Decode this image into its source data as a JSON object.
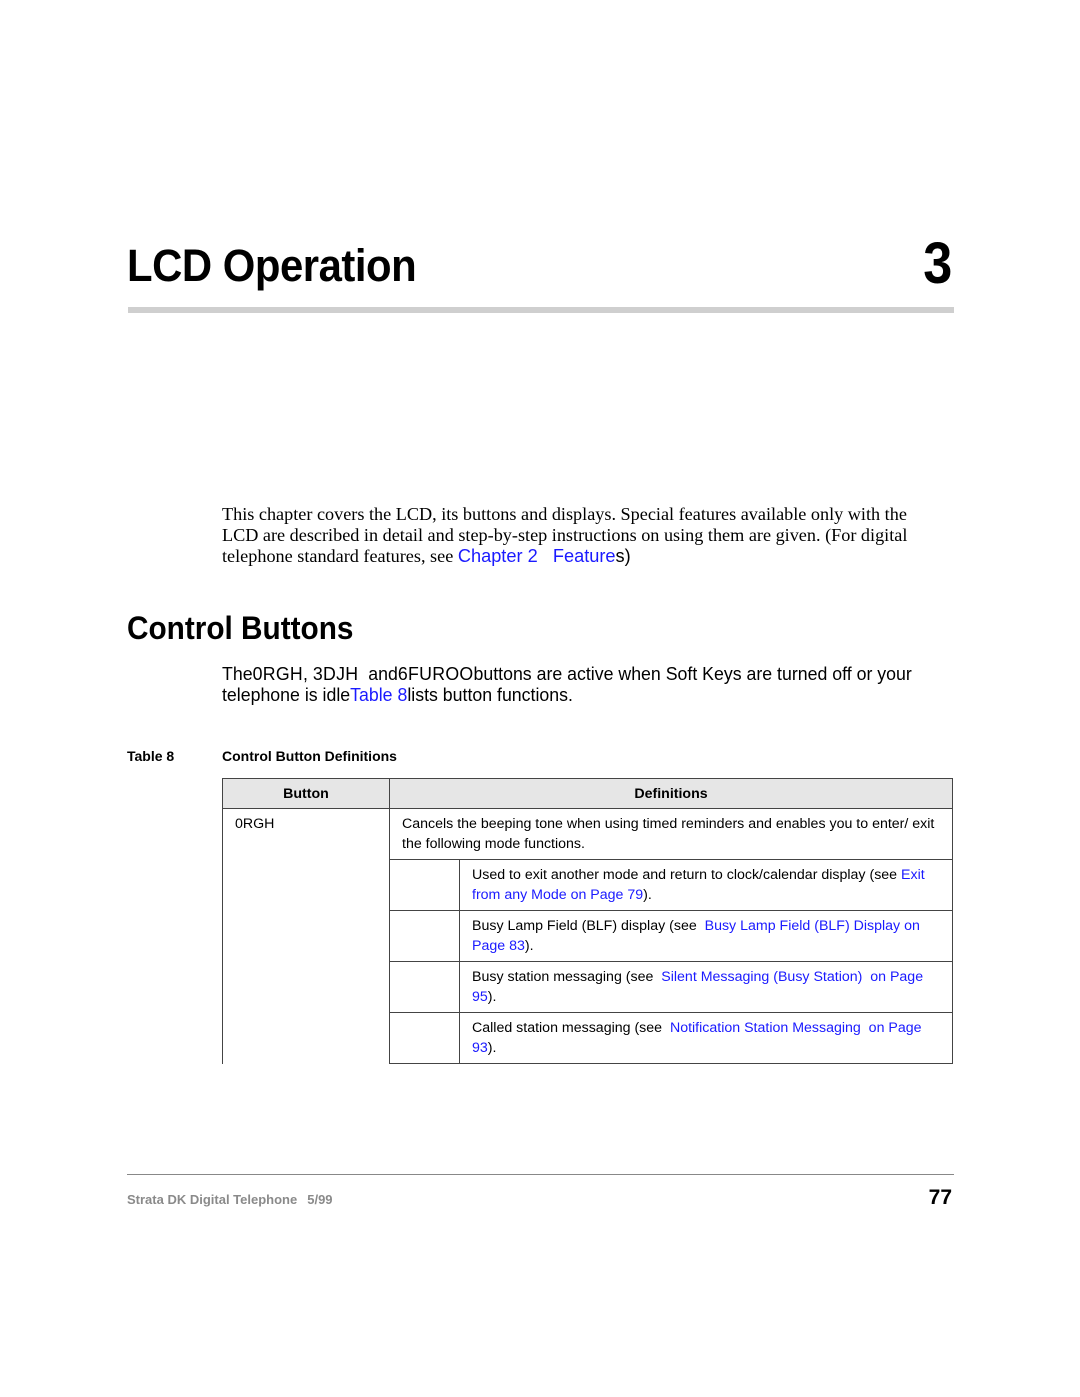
{
  "chapter": {
    "title": "LCD Operation",
    "number": "3"
  },
  "intro": {
    "line1": "This chapter covers the LCD, its buttons and displays. Special features available only with the",
    "line2": "LCD are described in detail and step-by-step instructions on using them are given. (For digital",
    "line3_prefix": "telephone standard features, see ",
    "line3_link": "Chapter 2   Feature",
    "line3_suffix": "s)"
  },
  "section": {
    "heading": "Control Buttons",
    "para": {
      "the": "The",
      "btn_mode": "0RGH",
      "sep1": ", ",
      "btn_page": "3DJH",
      "and": "  and",
      "btn_scroll": "6FUROO",
      "rest_line1": "buttons are active when Soft Keys are turned off or your",
      "line2_prefix": "telephone is idle",
      "line2_link": "Table 8",
      "line2_suffix": "lists button functions."
    }
  },
  "table": {
    "caption_label": "Table 8",
    "caption_title": "Control Button Definitions",
    "headers": [
      "Button",
      "Definitions"
    ],
    "rows": [
      {
        "button": "0RGH",
        "definition": "Cancels the beeping tone when using timed reminders and enables you to enter/ exit the following mode functions.",
        "subrows": [
          {
            "text": "Used to exit another mode and return to clock/calendar display (see ",
            "link": "Exit from any Mode  on Page 79",
            "suffix": ")."
          },
          {
            "text": "Busy Lamp Field (BLF) display (see  ",
            "link": "Busy Lamp Field (BLF) Display on Page 83",
            "suffix": ")."
          },
          {
            "text": "Busy station messaging (see  ",
            "link": "Silent Messaging (Busy Station)  on Page 95",
            "suffix": ")."
          },
          {
            "text": "Called station messaging (see  ",
            "link": "Notification Station Messaging  on Page 93",
            "suffix": ")."
          }
        ]
      }
    ]
  },
  "footer": {
    "doc_title": "Strata DK Digital Telephone",
    "date": "5/99",
    "page_number": "77"
  },
  "colors": {
    "link": "#1a1aff",
    "rule": "#cfcfcf",
    "header_bg": "#e6e6e6",
    "footer_text": "#8a8a8a"
  }
}
